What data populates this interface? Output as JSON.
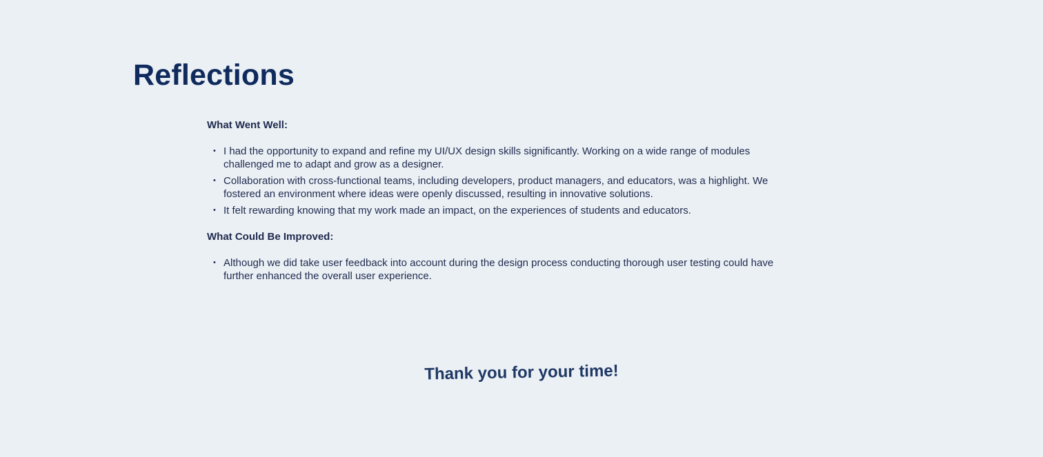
{
  "page": {
    "title": "Reflections",
    "closing": "Thank you for your time!"
  },
  "went_well": {
    "heading": "What Went Well:",
    "items": [
      {
        "text": "I had the opportunity to expand and refine my UI/UX design skills significantly. Working on a wide range of modules challenged me to adapt and grow as a designer."
      },
      {
        "text": "Collaboration with cross-functional teams, including developers, product managers, and educators, was a highlight. We fostered an environment where ideas were openly discussed, resulting in innovative solutions."
      },
      {
        "text": "It felt rewarding knowing that my work made an impact, on the experiences of students and educators."
      }
    ]
  },
  "could_improve": {
    "heading": "What Could Be Improved:",
    "items": [
      {
        "text": "Although we did take user feedback into account during the design process conducting thorough user testing could have further enhanced the overall user experience."
      }
    ]
  },
  "colors": {
    "background": "#ebf0f5",
    "title": "#0f2a5c",
    "text": "#1f2a4d"
  }
}
